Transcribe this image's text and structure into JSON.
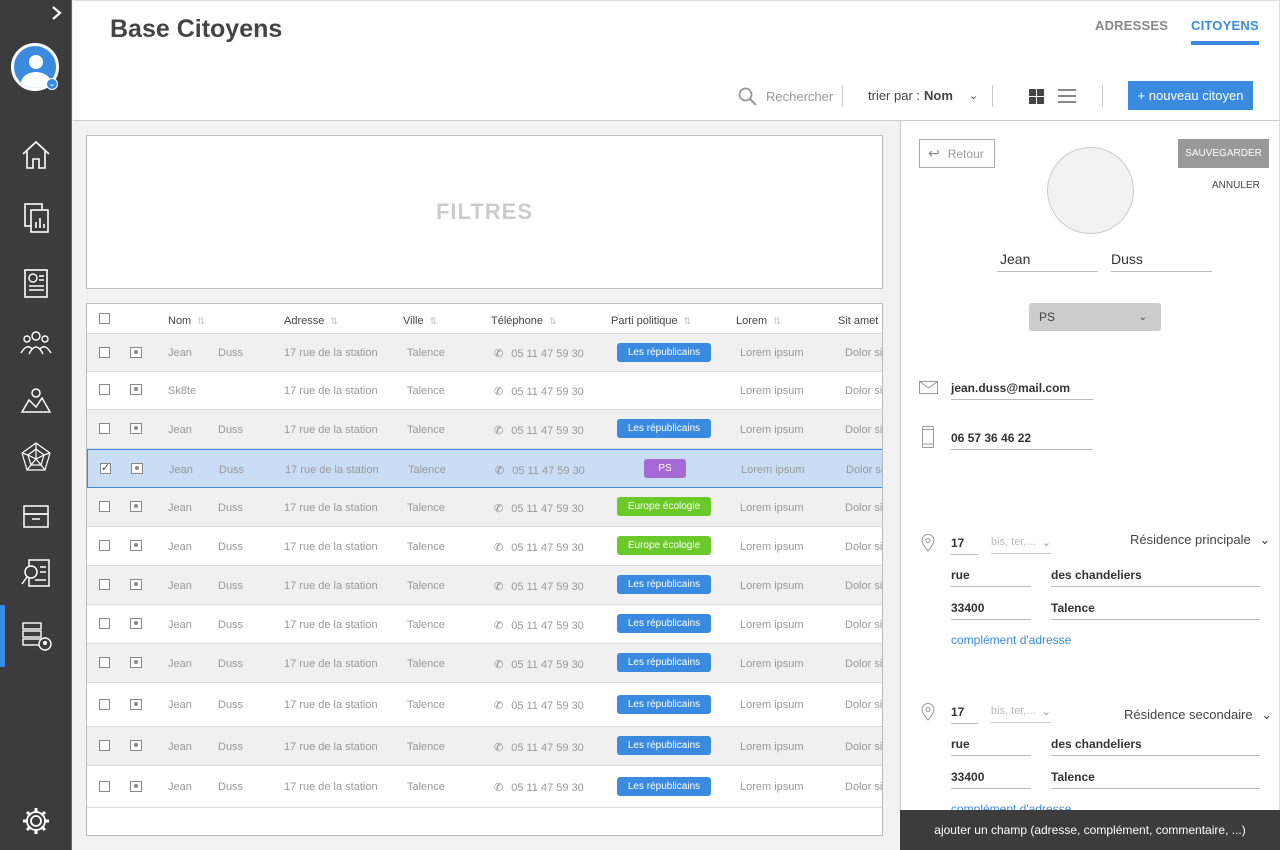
{
  "app": {
    "title": "Base Citoyens"
  },
  "tabs": [
    {
      "label": "ADRESSES"
    },
    {
      "label": "CITOYENS"
    }
  ],
  "toolbar": {
    "search_placeholder": "Rechercher",
    "sort_label": "trier par :",
    "sort_value": "Nom",
    "new_button": "+ nouveau citoyen"
  },
  "filters": {
    "label": "FILTRES"
  },
  "table": {
    "columns": [
      "Nom",
      "Adresse",
      "Ville",
      "Téléphone",
      "Parti politique",
      "Lorem",
      "Sit amet"
    ],
    "rows": [
      {
        "first": "Jean",
        "last": "Duss",
        "address": "17 rue de la station",
        "city": "Talence",
        "phone": "05 11 47 59 30",
        "party": "Les républicains",
        "lorem": "Lorem ipsum",
        "sit": "Dolor sit",
        "checked": false
      },
      {
        "first": "Sk8te",
        "last": "",
        "address": "17 rue de la station",
        "city": "Talence",
        "phone": "05 11 47 59 30",
        "party": "",
        "lorem": "Lorem ipsum",
        "sit": "Dolor sit",
        "checked": false
      },
      {
        "first": "Jean",
        "last": "Duss",
        "address": "17 rue de la station",
        "city": "Talence",
        "phone": "05 11 47 59 30",
        "party": "Les républicains",
        "lorem": "Lorem ipsum",
        "sit": "Dolor sit",
        "checked": false
      },
      {
        "first": "Jean",
        "last": "Duss",
        "address": "17 rue de la station",
        "city": "Talence",
        "phone": "05 11 47 59 30",
        "party": "PS",
        "lorem": "Lorem ipsum",
        "sit": "Dolor sit",
        "checked": true
      },
      {
        "first": "Jean",
        "last": "Duss",
        "address": "17 rue de la station",
        "city": "Talence",
        "phone": "05 11 47 59 30",
        "party": "Europe écologie",
        "lorem": "Lorem ipsum",
        "sit": "Dolor sit",
        "checked": false
      },
      {
        "first": "Jean",
        "last": "Duss",
        "address": "17 rue de la station",
        "city": "Talence",
        "phone": "05 11 47 59 30",
        "party": "Europe écologie",
        "lorem": "Lorem ipsum",
        "sit": "Dolor sit",
        "checked": false
      },
      {
        "first": "Jean",
        "last": "Duss",
        "address": "17 rue de la station",
        "city": "Talence",
        "phone": "05 11 47 59 30",
        "party": "Les républicains",
        "lorem": "Lorem ipsum",
        "sit": "Dolor sit",
        "checked": false
      },
      {
        "first": "Jean",
        "last": "Duss",
        "address": "17 rue de la station",
        "city": "Talence",
        "phone": "05 11 47 59 30",
        "party": "Les républicains",
        "lorem": "Lorem ipsum",
        "sit": "Dolor sit",
        "checked": false
      },
      {
        "first": "Jean",
        "last": "Duss",
        "address": "17 rue de la station",
        "city": "Talence",
        "phone": "05 11 47 59 30",
        "party": "Les républicains",
        "lorem": "Lorem ipsum",
        "sit": "Dolor sit",
        "checked": false
      },
      {
        "first": "Jean",
        "last": "Duss",
        "address": "17 rue de la station",
        "city": "Talence",
        "phone": "05 11 47 59 30",
        "party": "Les républicains",
        "lorem": "Lorem ipsum",
        "sit": "Dolor sit",
        "checked": false
      },
      {
        "first": "Jean",
        "last": "Duss",
        "address": "17 rue de la station",
        "city": "Talence",
        "phone": "05 11 47 59 30",
        "party": "Les républicains",
        "lorem": "Lorem ipsum",
        "sit": "Dolor sit",
        "checked": false
      },
      {
        "first": "Jean",
        "last": "Duss",
        "address": "17 rue de la station",
        "city": "Talence",
        "phone": "05 11 47 59 30",
        "party": "Les républicains",
        "lorem": "Lorem ipsum",
        "sit": "Dolor sit",
        "checked": false
      }
    ],
    "party_colors": {
      "Les républicains": "#3a8be0",
      "PS": "#a56ad4",
      "Europe écologie": "#6cc92a"
    }
  },
  "detail": {
    "back": "Retour",
    "save": "SAUVEGARDER",
    "cancel": "ANNULER",
    "first_name": "Jean",
    "last_name": "Duss",
    "party": "PS",
    "email": "jean.duss@mail.com",
    "phone": "06 57 36 46 22",
    "addresses": [
      {
        "number": "17",
        "suffix_placeholder": "bis, ter,...",
        "type": "Résidence principale",
        "street_type": "rue",
        "street": "des chandeliers",
        "zip": "33400",
        "city": "Talence",
        "complement": "complément d'adresse"
      },
      {
        "number": "17",
        "suffix_placeholder": "bis, ter,...",
        "type": "Résidence secondaire",
        "street_type": "rue",
        "street": "des chandeliers",
        "zip": "33400",
        "city": "Talence",
        "complement": "complément d'adresse"
      }
    ],
    "add_field": "ajouter un champ (adresse, complément, commentaire, ...)"
  },
  "colors": {
    "accent": "#3a8be0",
    "sidebar": "#3c3c3c"
  }
}
